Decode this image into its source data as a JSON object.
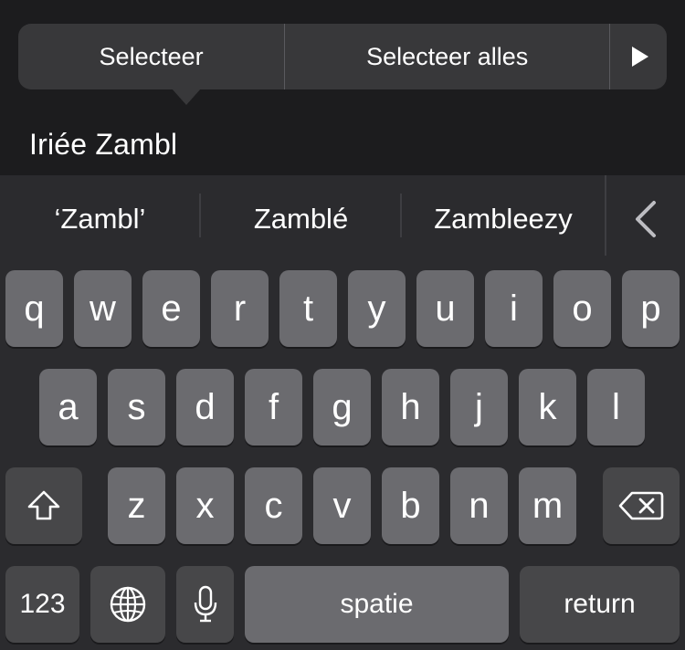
{
  "callout": {
    "select_label": "Selecteer",
    "select_all_label": "Selecteer alles",
    "more_icon": "play-icon"
  },
  "text_field": {
    "value": "Iriée Zambl"
  },
  "suggestions": [
    "‘Zambl’",
    "Zamblé",
    "Zambleezy"
  ],
  "keyboard": {
    "row1": [
      "q",
      "w",
      "e",
      "r",
      "t",
      "y",
      "u",
      "i",
      "o",
      "p"
    ],
    "row2": [
      "a",
      "s",
      "d",
      "f",
      "g",
      "h",
      "j",
      "k",
      "l"
    ],
    "row3": [
      "z",
      "x",
      "c",
      "v",
      "b",
      "n",
      "m"
    ],
    "numbers_label": "123",
    "space_label": "spatie",
    "return_label": "return",
    "icons": [
      "shift-icon",
      "delete-icon",
      "globe-icon",
      "microphone-icon",
      "chevron-left-icon"
    ]
  },
  "colors": {
    "background": "#1c1c1e",
    "keyboard_bg": "#2b2b2e",
    "letter_key": "#6b6b6f",
    "function_key": "#474749",
    "callout_bg": "#38383a"
  }
}
